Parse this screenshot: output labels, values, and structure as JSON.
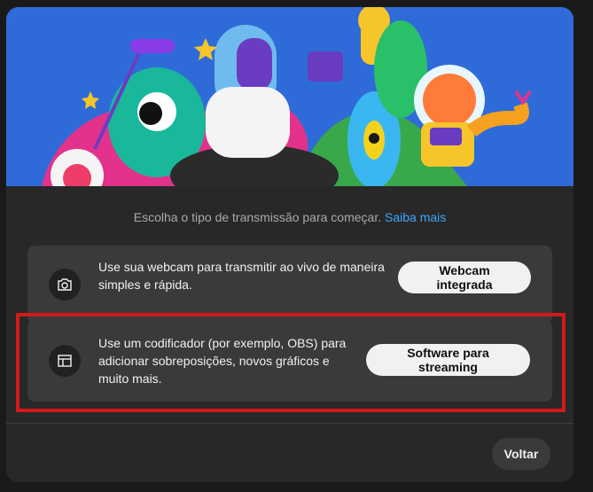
{
  "intro": {
    "text": "Escolha o tipo de transmissão para começar.",
    "link": "Saiba mais"
  },
  "options": [
    {
      "description": "Use sua webcam para transmitir ao vivo de maneira simples e rápida.",
      "button_label": "Webcam integrada",
      "icon": "camera-icon"
    },
    {
      "description": "Use um codificador (por exemplo, OBS) para adicionar sobreposições, novos gráficos e muito mais.",
      "button_label": "Software para streaming",
      "icon": "layout-icon"
    }
  ],
  "footer": {
    "back_label": "Voltar"
  },
  "colors": {
    "dialog_bg": "#282828",
    "card_bg": "#3a3a3a",
    "link": "#3ea6ff",
    "highlight": "#d11a1a",
    "hero_bg": "#2f6bd8"
  }
}
